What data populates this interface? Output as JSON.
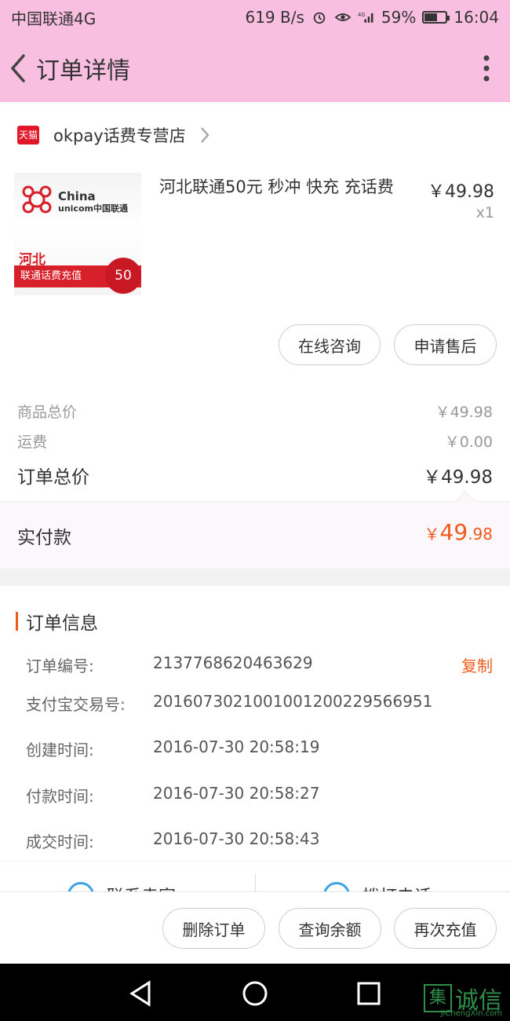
{
  "status_bar": {
    "carrier": "中国联通4G",
    "speed": "619 B/s",
    "battery_pct": "59%",
    "battery_level": 0.59,
    "time": "16:04"
  },
  "header": {
    "title": "订单详情",
    "back_icon": "chevron-left-icon",
    "more_icon": "more-vertical-icon"
  },
  "shop": {
    "badge": "天猫",
    "name": "okpay话费专营店",
    "chevron_icon": "chevron-right-icon"
  },
  "product": {
    "title": "河北联通50元  秒冲  快充 充话费",
    "price": "￥49.98",
    "quantity": "x1",
    "image": {
      "logo_text_line1": "China",
      "logo_text_line2": "unicom中国联通",
      "region": "河北",
      "ribbon": "联通话费充值",
      "seal": "50"
    }
  },
  "actions": {
    "consult": "在线咨询",
    "after_sales": "申请售后"
  },
  "prices": {
    "goods_total_label": "商品总价",
    "goods_total_value": "￥49.98",
    "shipping_label": "运费",
    "shipping_value": "￥0.00",
    "order_total_label": "订单总价",
    "order_total_value": "￥49.98"
  },
  "paid": {
    "label": "实付款",
    "yen": "￥",
    "integer": "49",
    "decimal": ".98"
  },
  "order_info": {
    "title": "订单信息",
    "copy_label": "复制",
    "rows": [
      {
        "label": "订单编号:",
        "value": "2137768620463629"
      },
      {
        "label": "支付宝交易号:",
        "value": "2016073021001001200229566951"
      },
      {
        "label": "创建时间:",
        "value": "2016-07-30 20:58:19"
      },
      {
        "label": "付款时间:",
        "value": "2016-07-30 20:58:27"
      },
      {
        "label": "成交时间:",
        "value": "2016-07-30 20:58:43"
      }
    ]
  },
  "contact": {
    "seller": "联系卖家",
    "call": "拨打电话"
  },
  "bottom_actions": {
    "delete": "删除订单",
    "balance": "查询余额",
    "recharge": "再次充值"
  },
  "watermark": {
    "box": "集",
    "text": "诚信",
    "sub": "JiChengXin.com"
  },
  "colors": {
    "header_bg": "#f8bfe0",
    "accent": "#ef5a1b",
    "tmall_red": "#e0182a"
  }
}
